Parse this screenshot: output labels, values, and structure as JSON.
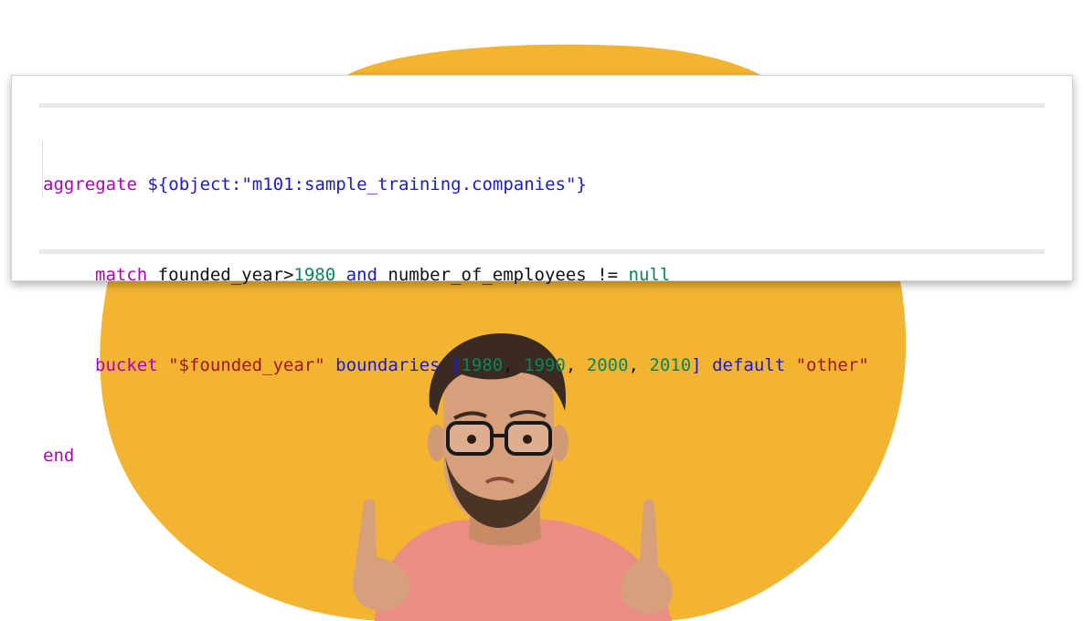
{
  "code": {
    "line1": {
      "keyword": "aggregate",
      "object_ref": "${object:\"m101:sample_training.companies\"}"
    },
    "line2": {
      "keyword": "match",
      "field": "founded_year",
      "op_gt": ">",
      "value_1980": "1980",
      "and": "and",
      "field2": "number_of_employees",
      "op_ne": "!=",
      "null": "null"
    },
    "line3": {
      "keyword": "bucket",
      "group_by": "\"$founded_year\"",
      "boundaries_kw": "boundaries",
      "open_bracket": "[",
      "b1": "1980",
      "b2": "1990",
      "b3": "2000",
      "b4": "2010",
      "close_bracket": "]",
      "default_kw": "default",
      "default_value": "\"other\""
    },
    "line4": {
      "keyword": "end"
    }
  },
  "colors": {
    "blob": "#f2b431",
    "sweater": "#ec8d84",
    "skin": "#d7a07d",
    "hair": "#3a2a22",
    "glasses": "#1a1a1a"
  }
}
